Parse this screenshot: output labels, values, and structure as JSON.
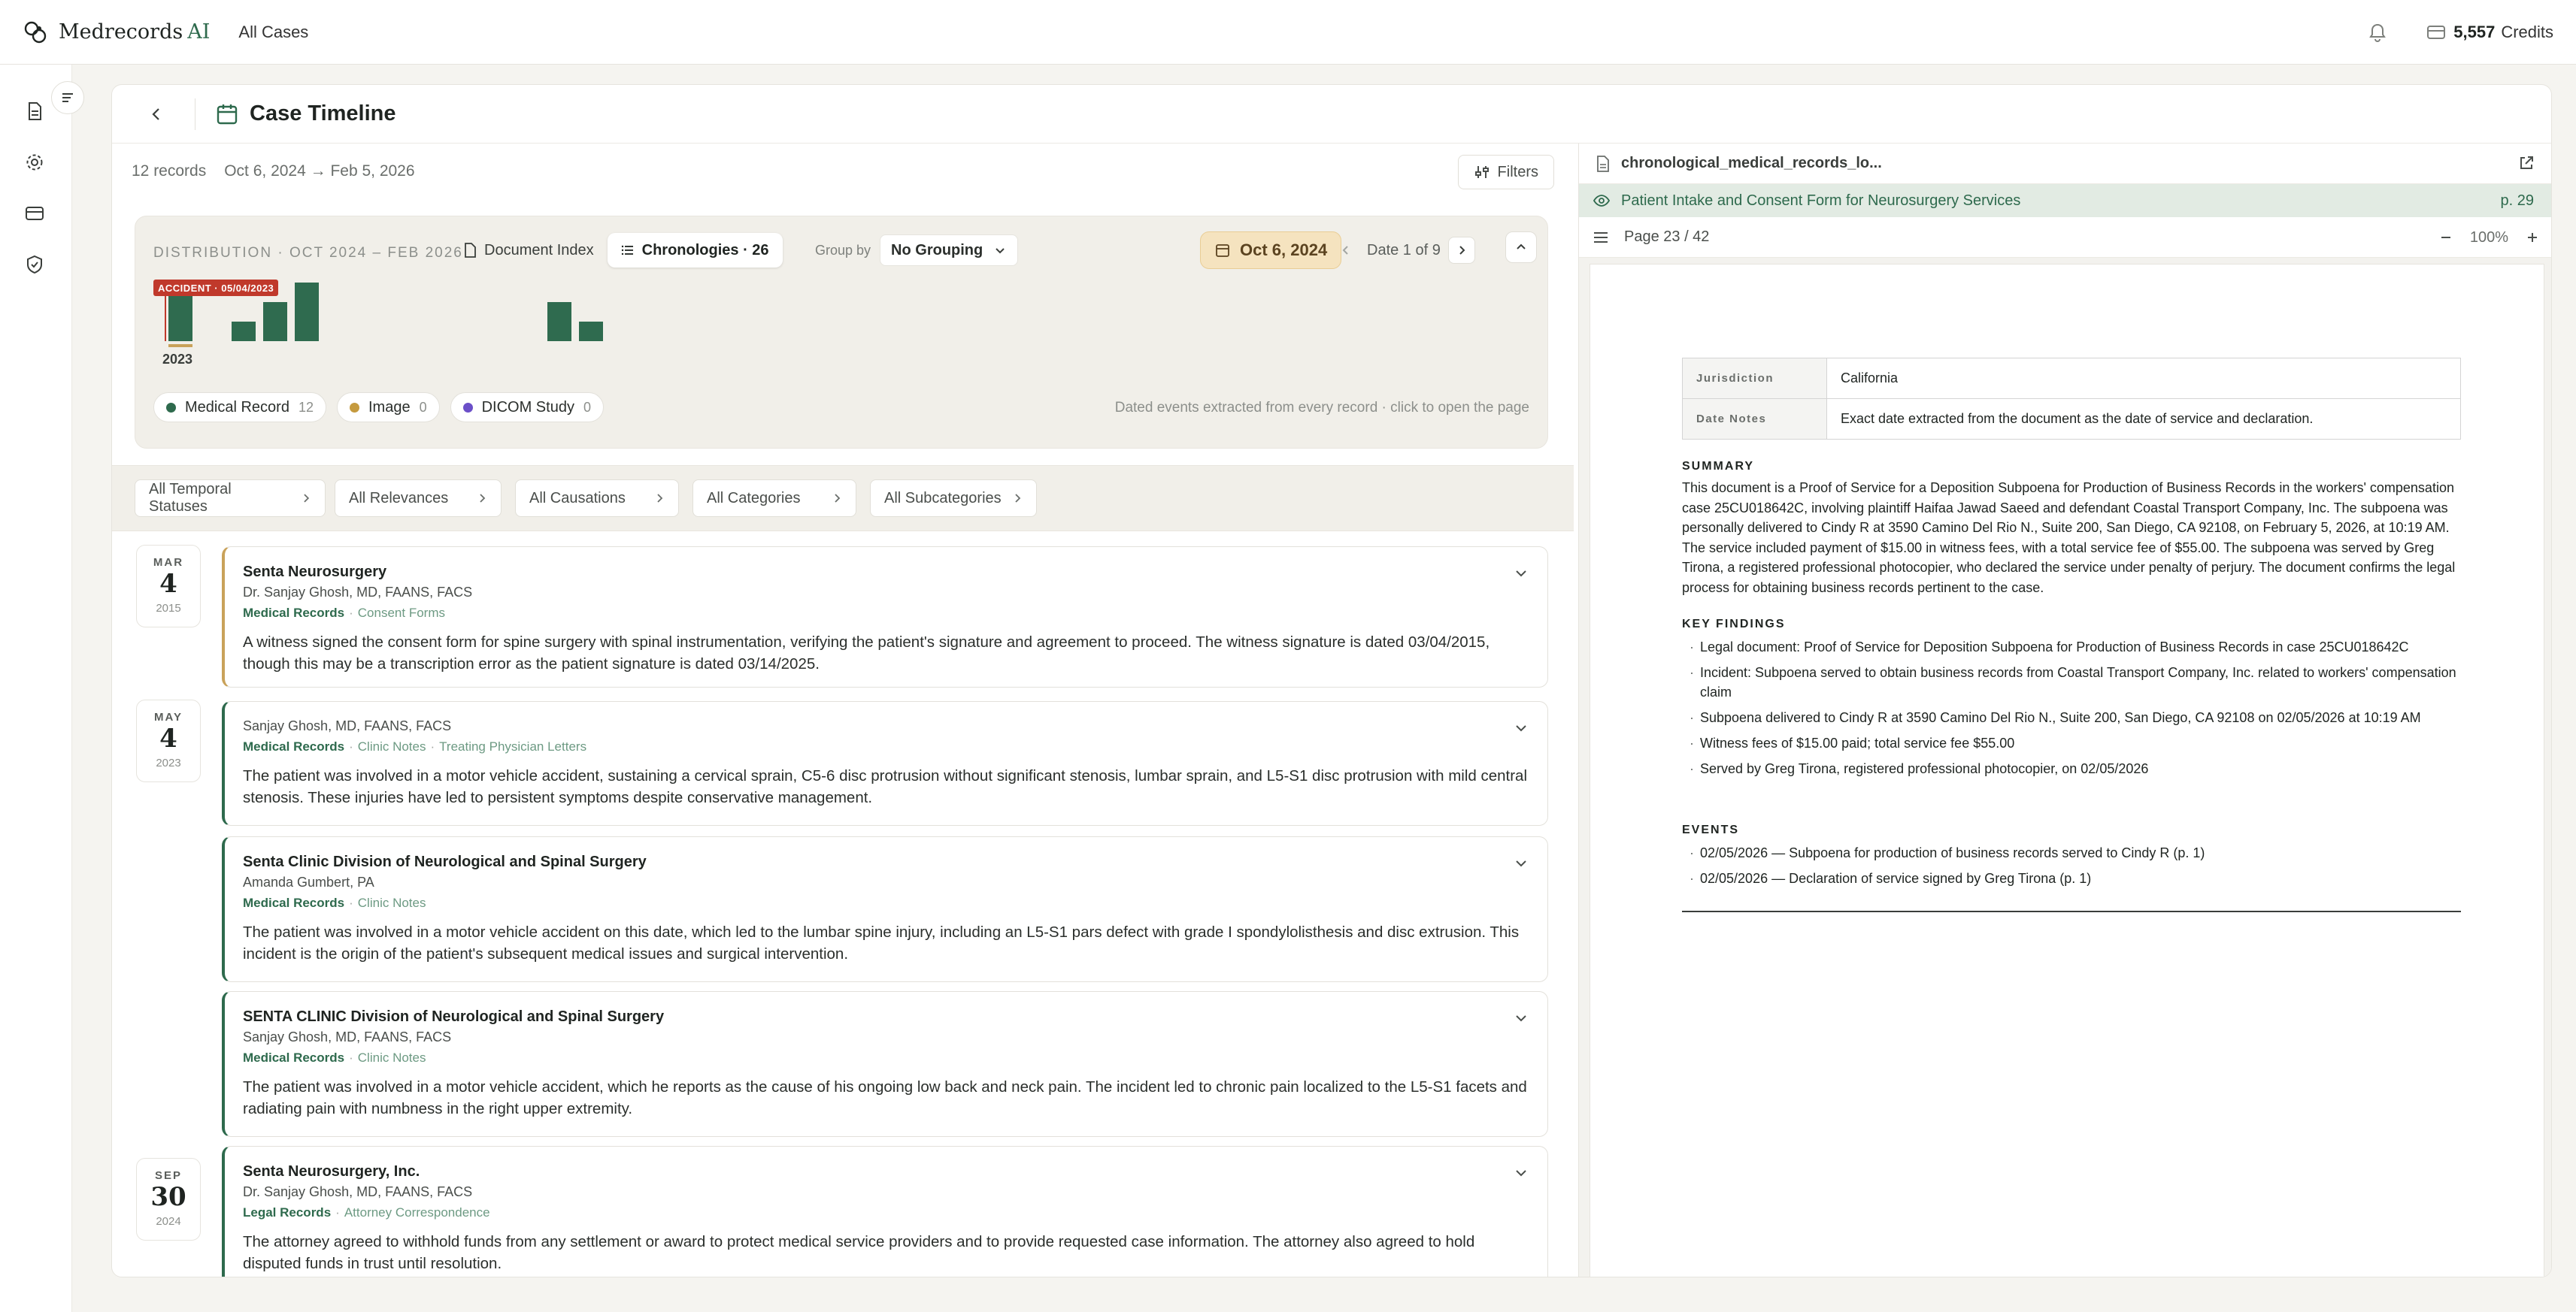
{
  "app": {
    "brand": "Medrecords",
    "brand_suffix": "AI",
    "breadcrumb": "All Cases",
    "credits_value": "5,557",
    "credits_label": "Credits"
  },
  "page": {
    "title": "Case Timeline"
  },
  "summary": {
    "records": "12 records",
    "date_range": "Oct 6, 2024 → Feb 5, 2026",
    "filters_label": "Filters"
  },
  "distribution": {
    "title": "DISTRIBUTION · OCT 2024 – FEB 2026",
    "tab_document_index": "Document Index",
    "tab_chronologies": "Chronologies · 26",
    "group_by_label": "Group by",
    "group_by_value": "No Grouping",
    "current_date": "Oct 6, 2024",
    "date_position": "Date 1 of 9",
    "accident_tag": "ACCIDENT · 05/04/2023",
    "year_label": "2023",
    "bars": [
      {
        "slot": 0,
        "count": 5,
        "highlight": true
      },
      {
        "slot": 2,
        "count": 2,
        "highlight": false
      },
      {
        "slot": 3,
        "count": 4,
        "highlight": false
      },
      {
        "slot": 4,
        "count": 6,
        "highlight": false
      },
      {
        "slot": 12,
        "count": 4,
        "highlight": false
      },
      {
        "slot": 13,
        "count": 2,
        "highlight": false
      }
    ],
    "legend": [
      {
        "label": "Medical Record",
        "count": "12",
        "color": "#2e6a4d"
      },
      {
        "label": "Image",
        "count": "0",
        "color": "#c59a3e"
      },
      {
        "label": "DICOM Study",
        "count": "0",
        "color": "#6b4fc8"
      }
    ],
    "hint": "Dated events extracted from every record · click to open the page"
  },
  "filters": [
    "All Temporal Statuses",
    "All Relevances",
    "All Causations",
    "All Categories",
    "All Subcategories"
  ],
  "dates": [
    {
      "month": "MAR",
      "day": "4",
      "year": "2015"
    },
    {
      "month": "MAY",
      "day": "4",
      "year": "2023"
    },
    {
      "month": "SEP",
      "day": "30",
      "year": "2024"
    }
  ],
  "events": [
    {
      "title": "Senta Neurosurgery",
      "provider": "Dr. Sanjay Ghosh, MD, FAANS, FACS",
      "category": "Medical Records",
      "subcategory": "Consent Forms",
      "subcategory2": "",
      "text": "A witness signed the consent form for spine surgery with spinal instrumentation, verifying the patient's signature and agreement to proceed. The witness signature is dated 03/04/2015, though this may be a transcription error as the patient signature is dated 03/14/2025.",
      "accent": "#c9a25a"
    },
    {
      "title": "",
      "provider": "Sanjay Ghosh, MD, FAANS, FACS",
      "category": "Medical Records",
      "subcategory": "Clinic Notes",
      "subcategory2": "Treating Physician Letters",
      "text": "The patient was involved in a motor vehicle accident, sustaining a cervical sprain, C5-6 disc protrusion without significant stenosis, lumbar sprain, and L5-S1 disc protrusion with mild central stenosis. These injuries have led to persistent symptoms despite conservative management.",
      "accent": "#2e6a4d"
    },
    {
      "title": "Senta Clinic Division of Neurological and Spinal Surgery",
      "provider": "Amanda Gumbert, PA",
      "category": "Medical Records",
      "subcategory": "Clinic Notes",
      "subcategory2": "",
      "text": "The patient was involved in a motor vehicle accident on this date, which led to the lumbar spine injury, including an L5-S1 pars defect with grade I spondylolisthesis and disc extrusion. This incident is the origin of the patient's subsequent medical issues and surgical intervention.",
      "accent": "#2e6a4d"
    },
    {
      "title": "SENTA CLINIC Division of Neurological and Spinal Surgery",
      "provider": "Sanjay Ghosh, MD, FAANS, FACS",
      "category": "Medical Records",
      "subcategory": "Clinic Notes",
      "subcategory2": "",
      "text": "The patient was involved in a motor vehicle accident, which he reports as the cause of his ongoing low back and neck pain. The incident led to chronic pain localized to the L5-S1 facets and radiating pain with numbness in the right upper extremity.",
      "accent": "#2e6a4d"
    },
    {
      "title": "Senta Neurosurgery, Inc.",
      "provider": "Dr. Sanjay Ghosh, MD, FAANS, FACS",
      "category": "Legal Records",
      "subcategory": "Attorney Correspondence",
      "subcategory2": "",
      "text": "The attorney agreed to withhold funds from any settlement or award to protect medical service providers and to provide requested case information. The attorney also agreed to hold disputed funds in trust until resolution.",
      "accent": "#2e6a4d"
    }
  ],
  "viewer": {
    "file_name": "chronological_medical_records_lo...",
    "banner_title": "Patient Intake and Consent Form for Neurosurgery Services",
    "banner_page": "p. 29",
    "page_indicator": "Page 23 / 42",
    "zoom": "100%"
  },
  "document": {
    "kv": [
      {
        "key": "Jurisdiction",
        "value": "California"
      },
      {
        "key": "Date Notes",
        "value": "Exact date extracted from the document as the date of service and declaration."
      }
    ],
    "summary_heading": "SUMMARY",
    "summary_text": "This document is a Proof of Service for a Deposition Subpoena for Production of Business Records in the workers' compensation case 25CU018642C, involving plaintiff Haifaa Jawad Saeed and defendant Coastal Transport Company, Inc. The subpoena was personally delivered to Cindy R at 3590 Camino Del Rio N., Suite 200, San Diego, CA 92108, on February 5, 2026, at 10:19 AM. The service included payment of $15.00 in witness fees, with a total service fee of $55.00. The subpoena was served by Greg Tirona, a registered professional photocopier, who declared the service under penalty of perjury. The document confirms the legal process for obtaining business records pertinent to the case.",
    "findings_heading": "KEY FINDINGS",
    "findings": [
      "Legal document: Proof of Service for Deposition Subpoena for Production of Business Records in case 25CU018642C",
      "Incident: Subpoena served to obtain business records from Coastal Transport Company, Inc. related to workers' compensation claim",
      "Subpoena delivered to Cindy R at 3590 Camino Del Rio N., Suite 200, San Diego, CA 92108 on 02/05/2026 at 10:19 AM",
      "Witness fees of $15.00 paid; total service fee $55.00",
      "Served by Greg Tirona, registered professional photocopier, on 02/05/2026"
    ],
    "events_heading": "EVENTS",
    "events": [
      "02/05/2026 — Subpoena for production of business records served to Cindy R (p. 1)",
      "02/05/2026 — Declaration of service signed by Greg Tirona (p. 1)"
    ]
  }
}
